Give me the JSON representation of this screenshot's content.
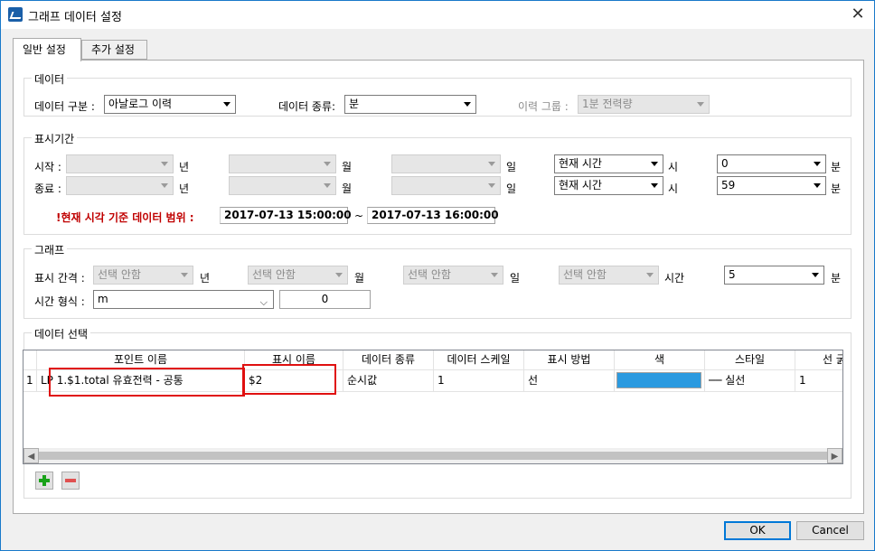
{
  "window": {
    "title": "그래프 데이터 설정",
    "close_glyph": "✕"
  },
  "tabs": [
    {
      "label": "일반 설정"
    },
    {
      "label": "추가 설정"
    }
  ],
  "data_group": {
    "title": "데이터",
    "type_label": "데이터 구분 :",
    "type_value": "아날로그 이력",
    "kind_label": "데이터 종류:",
    "kind_value": "분",
    "history_label": "이력 그룹 :",
    "history_value": "1분 전력량"
  },
  "period_group": {
    "title": "표시기간",
    "start_label": "시작 :",
    "end_label": "종료 :",
    "year": "년",
    "month": "월",
    "day": "일",
    "hour": "시",
    "minute": "분",
    "start_hour_value": "현재 시간",
    "start_minute_value": "0",
    "end_hour_value": "현재 시간",
    "end_minute_value": "59",
    "range_label": "!현재 시각 기준 데이터 범위 :",
    "range_from": "2017-07-13 15:00:00",
    "range_sep": "~",
    "range_to": "2017-07-13 16:00:00"
  },
  "graph_group": {
    "title": "그래프",
    "interval_label": "표시 간격 :",
    "unselected": "선택 안함",
    "year": "년",
    "month": "월",
    "day": "일",
    "hour": "시간",
    "minute": "분",
    "minute_value": "5",
    "format_label": "시간 형식 :",
    "format_value": "m",
    "format_number": "0"
  },
  "selection_group": {
    "title": "데이터 선택",
    "columns": [
      "포인트 이름",
      "표시 이름",
      "데이터 종류",
      "데이터 스케일",
      "표시 방법",
      "색",
      "스타일",
      "선 ⁠굵"
    ],
    "row": {
      "index": "1",
      "point_name": "LP 1.$1.total 유효전력 - 공통",
      "display_name": "$2",
      "data_kind": "순시값",
      "scale": "1",
      "method": "선",
      "color": "#2b9ae0",
      "style": "── 실선",
      "width": "1"
    }
  },
  "buttons": {
    "ok": "OK",
    "cancel": "Cancel"
  }
}
